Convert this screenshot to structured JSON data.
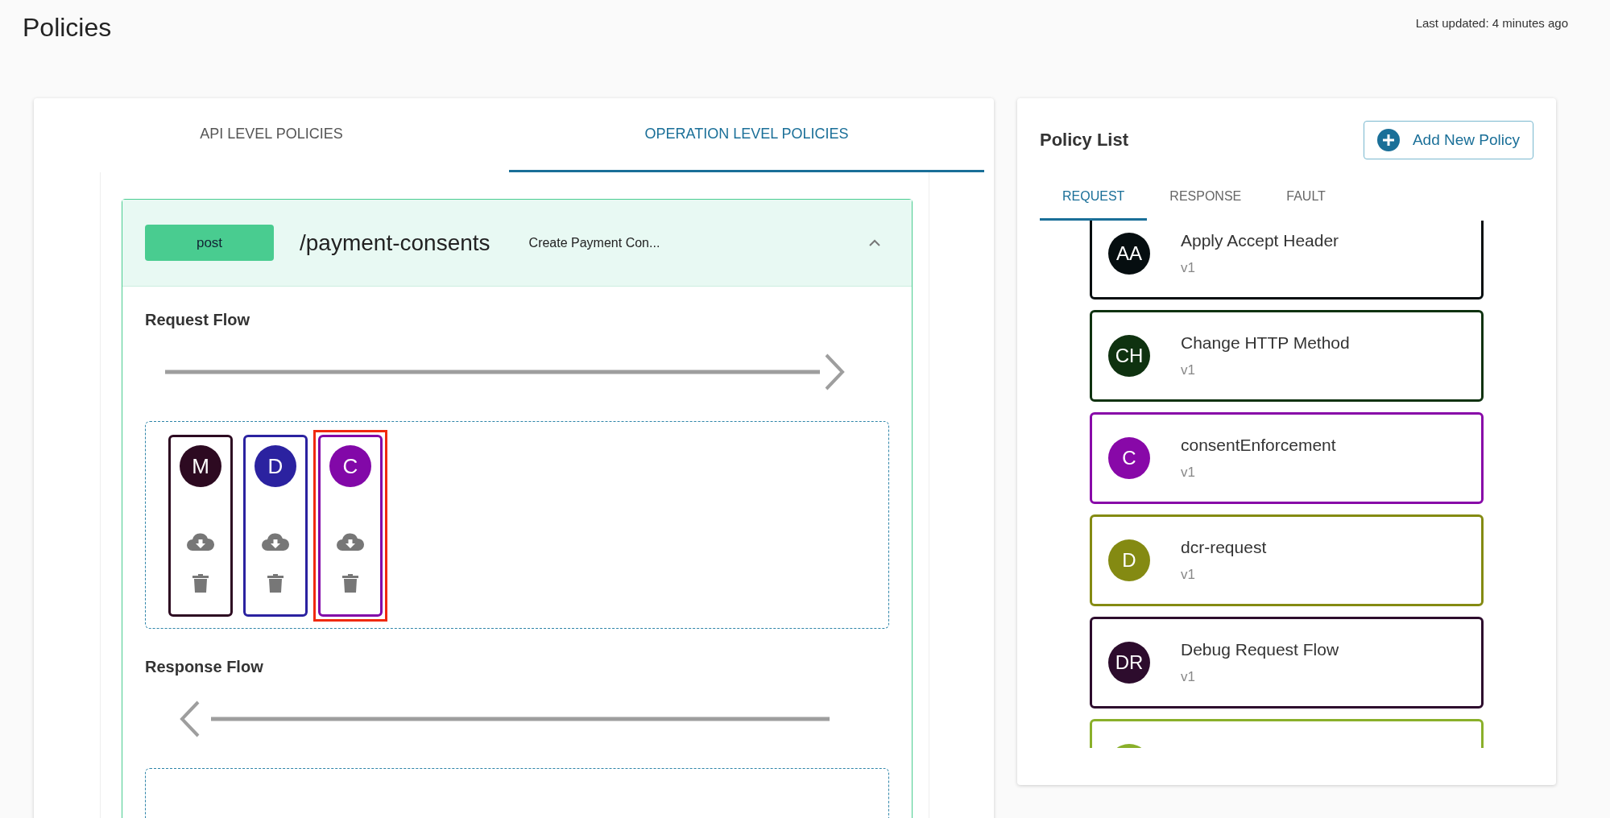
{
  "page": {
    "title": "Policies",
    "last_updated": "Last updated: 4 minutes ago"
  },
  "level_tabs": [
    {
      "label": "API LEVEL POLICIES",
      "selected": false
    },
    {
      "label": "OPERATION LEVEL POLICIES",
      "selected": true
    }
  ],
  "operation": {
    "method": "post",
    "path": "/payment-consents",
    "description": "Create Payment Con...",
    "expanded": true,
    "flows": [
      {
        "title": "Request Flow",
        "kind": "request",
        "policies": [
          {
            "initials": "M",
            "color": "#2d0a21",
            "selected": false
          },
          {
            "initials": "D",
            "color": "#2b22a0",
            "selected": false
          },
          {
            "initials": "C",
            "color": "#8208a8",
            "selected": true
          }
        ]
      },
      {
        "title": "Response Flow",
        "kind": "response"
      }
    ]
  },
  "policy_list": {
    "title": "Policy List",
    "add_button": "Add New Policy",
    "tabs": [
      {
        "label": "REQUEST",
        "selected": true
      },
      {
        "label": "RESPONSE",
        "selected": false
      },
      {
        "label": "FAULT",
        "selected": false
      }
    ],
    "items": [
      {
        "initials": "AA",
        "name": "Apply Accept Header",
        "version": "v1",
        "color": "#060e10"
      },
      {
        "initials": "CH",
        "name": "Change HTTP Method",
        "version": "v1",
        "color": "#0f3210"
      },
      {
        "initials": "C",
        "name": "consentEnforcement",
        "version": "v1",
        "color": "#8808a8"
      },
      {
        "initials": "D",
        "name": "dcr-request",
        "version": "v1",
        "color": "#848a12"
      },
      {
        "initials": "DR",
        "name": "Debug Request Flow",
        "version": "v1",
        "color": "#2d0c2d"
      },
      {
        "color": "#8ab02a"
      }
    ]
  }
}
